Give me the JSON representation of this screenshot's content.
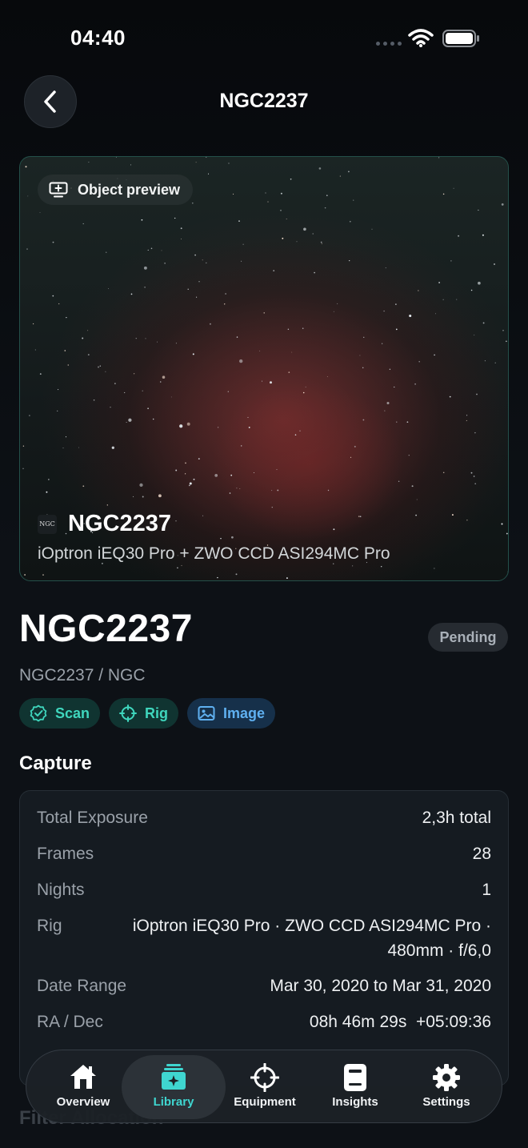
{
  "status_bar": {
    "time": "04:40"
  },
  "header": {
    "title": "NGC2237"
  },
  "preview": {
    "badge_label": "Object preview",
    "logo_text": "NGC",
    "name": "NGC2237",
    "subtitle": "iOptron iEQ30 Pro + ZWO CCD ASI294MC Pro"
  },
  "object": {
    "title": "NGC2237",
    "status": "Pending",
    "subtitle": "NGC2237 / NGC",
    "chips": [
      {
        "label": "Scan",
        "icon": "check-badge-icon"
      },
      {
        "label": "Rig",
        "icon": "crosshair-icon"
      },
      {
        "label": "Image",
        "icon": "image-icon"
      }
    ]
  },
  "capture": {
    "title": "Capture",
    "rows": [
      {
        "label": "Total Exposure",
        "value": "2,3h total"
      },
      {
        "label": "Frames",
        "value": "28"
      },
      {
        "label": "Nights",
        "value": "1"
      },
      {
        "label": "Rig",
        "value_line1": "iOptron iEQ30 Pro · ZWO CCD ASI294MC Pro ·",
        "value_line2": "480mm · f/6,0"
      },
      {
        "label": "Date Range",
        "value": "Mar 30, 2020 to Mar 31, 2020"
      },
      {
        "label": "RA / Dec",
        "value": "08h 46m 29s  +05:09:36"
      }
    ]
  },
  "next_section": {
    "title": "Filter Allocation"
  },
  "tabbar": {
    "active": "Library",
    "accent_color": "#3fd6d0",
    "items": [
      {
        "label": "Overview",
        "icon": "house-icon"
      },
      {
        "label": "Library",
        "icon": "library-sparkle-icon"
      },
      {
        "label": "Equipment",
        "icon": "crosshair-icon"
      },
      {
        "label": "Insights",
        "icon": "document-icon"
      },
      {
        "label": "Settings",
        "icon": "gear-icon"
      }
    ]
  }
}
